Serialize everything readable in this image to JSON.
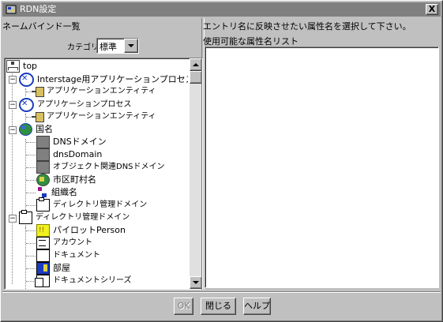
{
  "window": {
    "title": "RDN設定",
    "close_symbol": "X"
  },
  "left_panel": {
    "header": "ネームバインド一覧",
    "category_label": "カテゴリ:",
    "category_value": "標準"
  },
  "tree": {
    "items": [
      {
        "label": "top",
        "icon": "top-icon"
      },
      {
        "label": "Interstage用アプリケーションプロセス",
        "icon": "process-icon"
      },
      {
        "label": "アプリケーションエンティティ",
        "icon": "entity-icon"
      },
      {
        "label": "アプリケーションプロセス",
        "icon": "process-icon"
      },
      {
        "label": "アプリケーションエンティティ",
        "icon": "entity-icon"
      },
      {
        "label": "国名",
        "icon": "globe-icon"
      },
      {
        "label": "DNSドメイン",
        "icon": "gray-box-icon"
      },
      {
        "label": "dnsDomain",
        "icon": "gray-box-icon"
      },
      {
        "label": "オブジェクト関連DNSドメイン",
        "icon": "gray-box-icon"
      },
      {
        "label": "市区町村名",
        "icon": "city-icon"
      },
      {
        "label": "組織名",
        "icon": "organization-icon"
      },
      {
        "label": "ディレクトリ管理ドメイン",
        "icon": "folder-icon"
      },
      {
        "label": "ディレクトリ管理ドメイン",
        "icon": "folder-icon"
      },
      {
        "label": "パイロットPerson",
        "icon": "pilot-person-icon"
      },
      {
        "label": "アカウント",
        "icon": "account-icon"
      },
      {
        "label": "ドキュメント",
        "icon": "document-icon"
      },
      {
        "label": "部屋",
        "icon": "room-icon"
      },
      {
        "label": "ドキュメントシリーズ",
        "icon": "document-series-icon"
      }
    ]
  },
  "right_panel": {
    "header": "エントリ名に反映させたい属性名を選択して下さい。",
    "list_title": "使用可能な属性名リスト"
  },
  "buttons": {
    "ok": "OK",
    "close": "閉じる",
    "help": "ヘルプ"
  }
}
